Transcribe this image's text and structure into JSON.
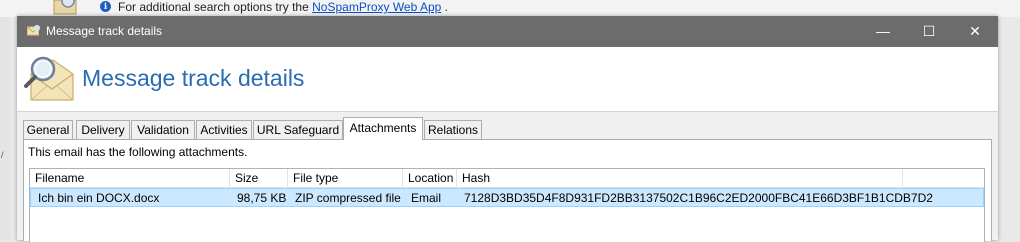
{
  "background": {
    "info_text": "For additional search options try the",
    "info_link": "NoSpamProxy Web App",
    "info_suffix": " .",
    "left_mark": "/"
  },
  "window": {
    "title": "Message track details",
    "header_title": "Message track details",
    "controls": {
      "minimize": "—",
      "maximize": "☐",
      "close": "✕"
    }
  },
  "tabs": [
    {
      "label": "General"
    },
    {
      "label": "Delivery"
    },
    {
      "label": "Validation"
    },
    {
      "label": "Activities"
    },
    {
      "label": "URL Safeguard"
    },
    {
      "label": "Attachments"
    },
    {
      "label": "Relations"
    }
  ],
  "active_tab": "Attachments",
  "attachments": {
    "description": "This email has the following attachments.",
    "columns": [
      "Filename",
      "Size",
      "File type",
      "Location",
      "Hash"
    ],
    "rows": [
      {
        "filename": "Ich bin ein DOCX.docx",
        "size": "98,75 KB",
        "file_type": "ZIP compressed file",
        "location": "Email",
        "hash": "7128D3BD35D4F8D931FD2BB3137502C1B96C2ED2000FBC41E66D3BF1B1CDB7D2"
      }
    ]
  },
  "icons": {
    "info": "info-icon",
    "title_icon": "envelope-icon",
    "header_logo": "envelope-magnifier-icon"
  },
  "colors": {
    "title_bar": "#6c6c6c",
    "header_title": "#2a6cb0",
    "selection": "#cce8ff",
    "link": "#0a4ec9"
  }
}
